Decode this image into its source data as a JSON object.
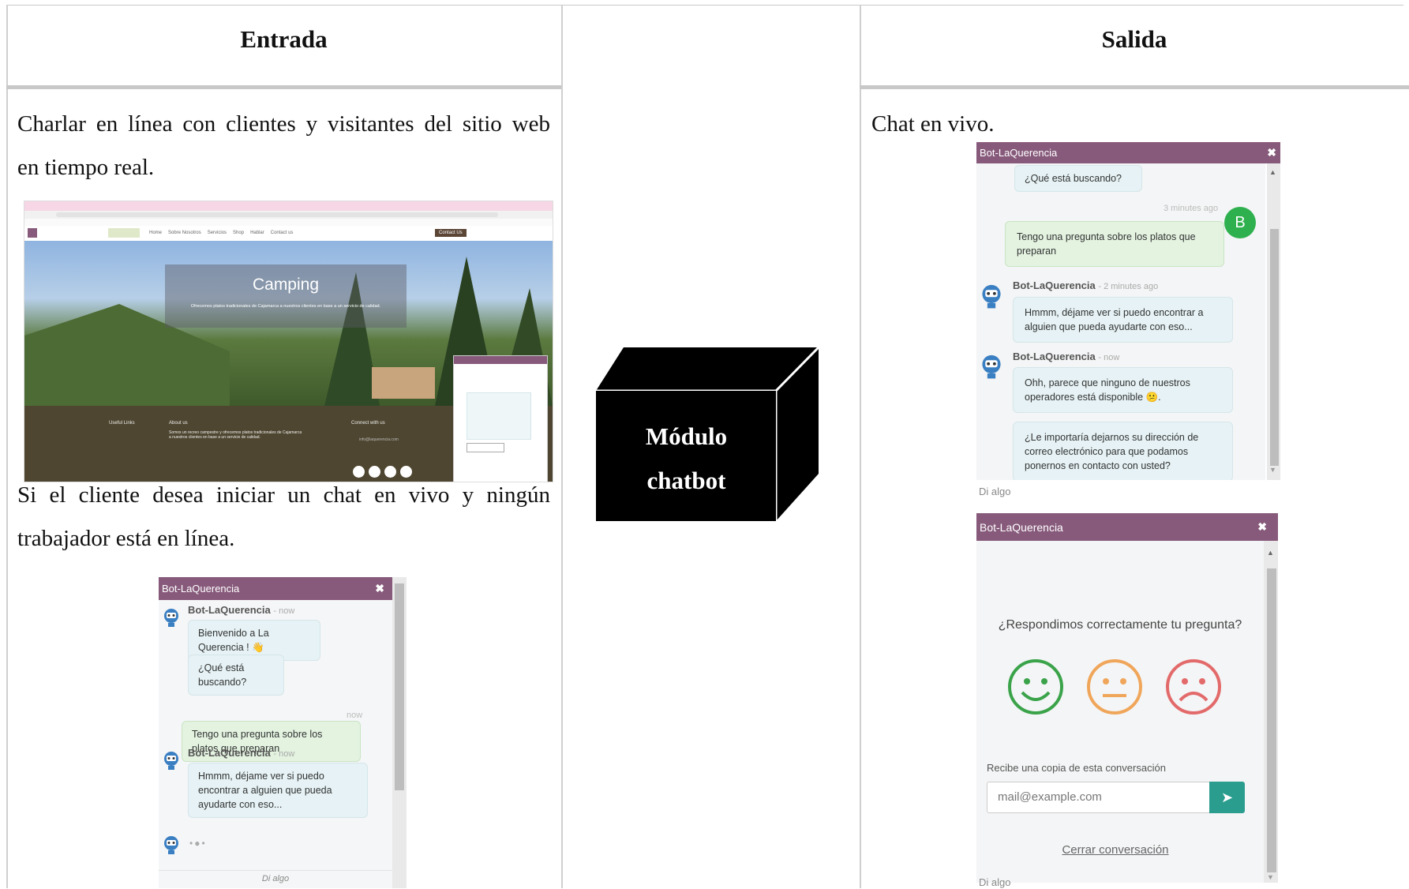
{
  "columns": {
    "left_header": "Entrada",
    "right_header": "Salida"
  },
  "left": {
    "para1_line1": "Charlar en línea con clientes y visitantes del sitio web",
    "para1_line2": "en tiempo real.",
    "para2_line1": "Si el cliente desea iniciar un chat en vivo y ningún",
    "para2_line2": "trabajador está en línea.",
    "website": {
      "hero_title": "Camping",
      "hero_subtitle": "Ofrecemos platos tradicionales de Cajamarca a nuestros clientes en base a un servicio de calidad.",
      "nav": [
        "Home",
        "Sobre Nosotros",
        "Servicios",
        "Shop",
        "Hablar",
        "Contact us"
      ],
      "contact_button": "Contact Us",
      "footer_useful": "Useful Links",
      "footer_about": "About us",
      "footer_about_text": "Somos un recreo campestre y ofrecemos platos tradicionales de Cajamarca a nuestros clientes en base a un servicio de calidad.",
      "footer_connect": "Connect with us",
      "footer_email": "info@laquerencia.com"
    },
    "chat": {
      "title": "Bot-LaQuerencia",
      "author": "Bot-LaQuerencia",
      "time_now": "- now",
      "msg1": "Bienvenido a La Querencia ! 👋",
      "msg2": "¿Qué está buscando?",
      "stamp": "now",
      "user_msg": "Tengo una pregunta sobre los platos que preparan",
      "msg3": "Hmmm, déjame ver si puedo encontrar a alguien que pueda ayudarte con eso...",
      "compose": "Di algo"
    }
  },
  "center": {
    "cube_line1": "Módulo",
    "cube_line2": "chatbot"
  },
  "right": {
    "para": "Chat en vivo.",
    "chat1": {
      "title": "Bot-LaQuerencia",
      "msg_top": "¿Qué está buscando?",
      "stamp": "3 minutes ago",
      "avatar_letter": "B",
      "user_msg": "Tengo una pregunta sobre los platos que preparan",
      "author": "Bot-LaQuerencia",
      "time1": "- 2 minutes ago",
      "msg1": "Hmmm, déjame ver si puedo encontrar a alguien que pueda ayudarte con eso...",
      "time2": "- now",
      "msg2": "Ohh, parece que ninguno de nuestros operadores está disponible 😕.",
      "msg3": "¿Le importaría dejarnos su dirección de correo electrónico para que podamos ponernos en contacto con usted?",
      "compose": "Di algo"
    },
    "chat2": {
      "title": "Bot-LaQuerencia",
      "question": "¿Respondimos correctamente tu pregunta?",
      "copy_label": "Recibe una copia de esta conversación",
      "email_placeholder": "mail@example.com",
      "close_link": "Cerrar conversación",
      "compose": "Di algo"
    }
  },
  "colors": {
    "chat_header": "#875a7b",
    "footer_brown": "#4e4630",
    "send_button": "#2a9d8f",
    "happy": "#3aa34a",
    "neutral": "#f0a65a",
    "sad": "#e36a6a"
  }
}
